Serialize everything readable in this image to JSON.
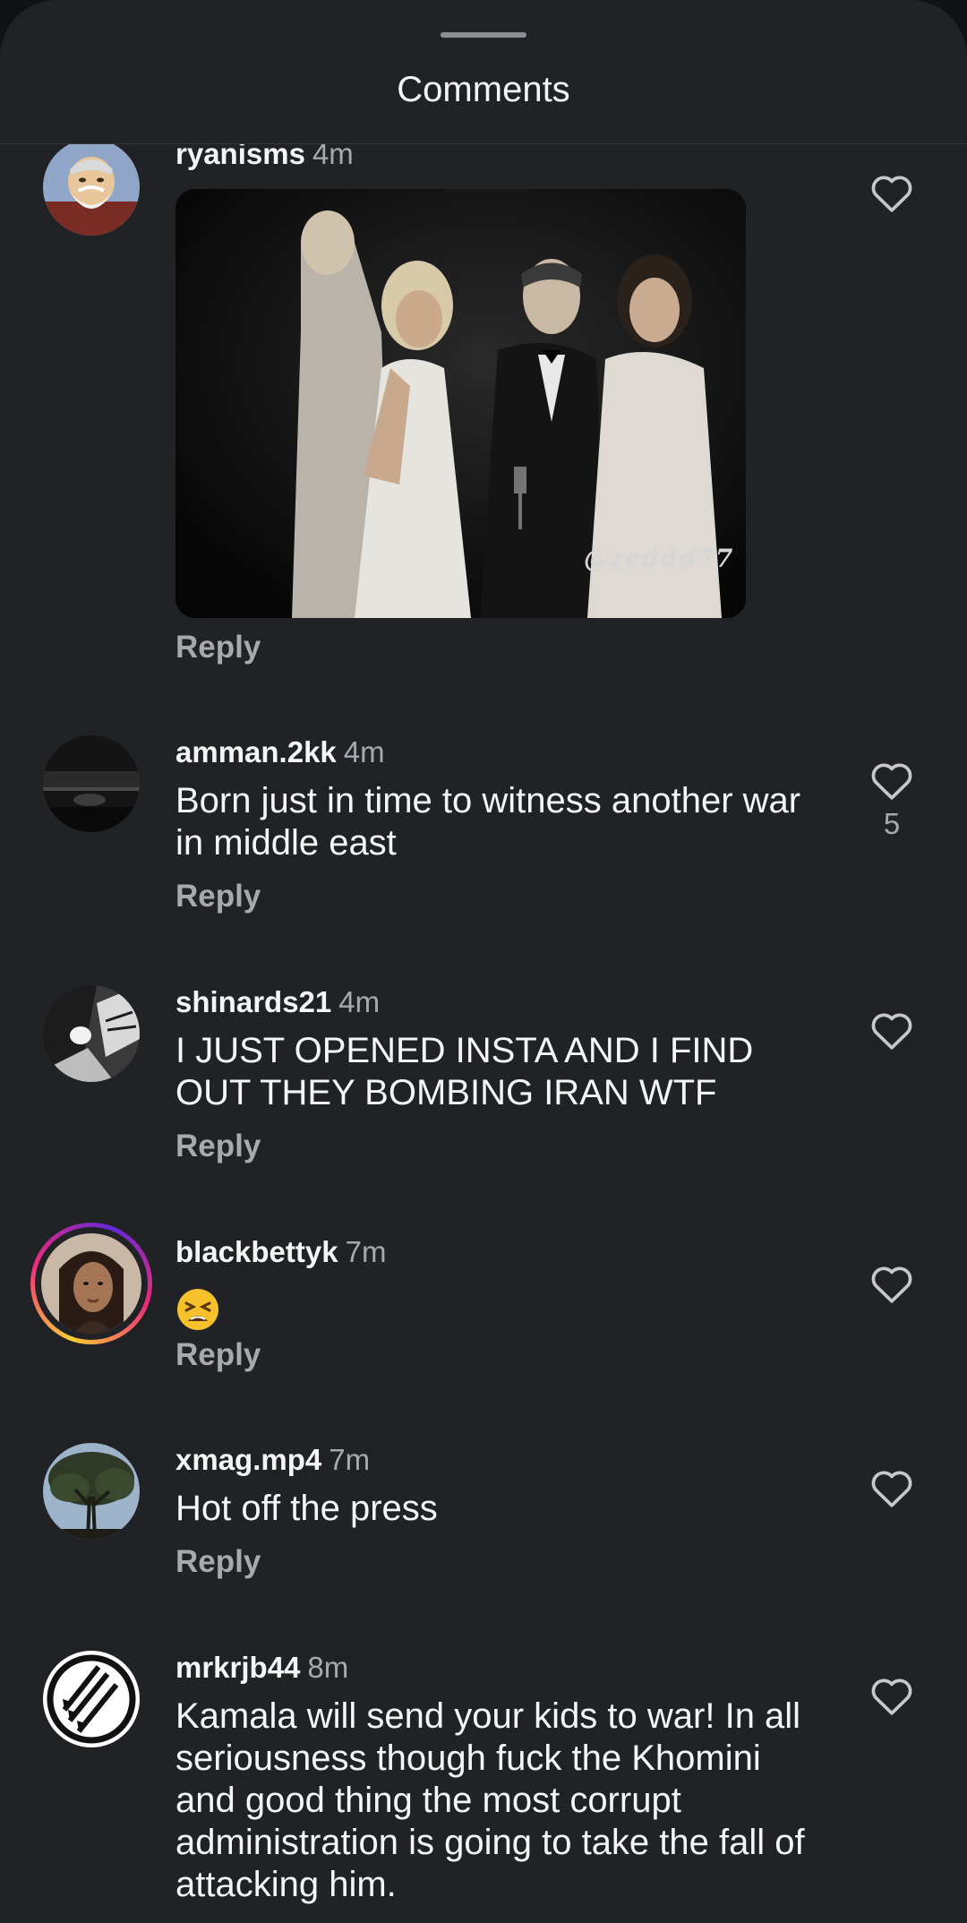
{
  "header": {
    "title": "Comments"
  },
  "comments": [
    {
      "username": "ryanisms",
      "time": "4m",
      "media_watermark": "@zeddd77",
      "reply_label": "Reply",
      "avatar_icon": "cartoon-old-man-avatar"
    },
    {
      "username": "amman.2kk",
      "time": "4m",
      "text": "Born just in time to witness another war in middle east",
      "reply_label": "Reply",
      "likes": "5",
      "avatar_icon": "dark-racing-photo-avatar"
    },
    {
      "username": "shinards21",
      "time": "4m",
      "text": "I JUST OPENED INSTA AND I FIND OUT THEY BOMBING IRAN WTF",
      "reply_label": "Reply",
      "avatar_icon": "manga-panel-avatar"
    },
    {
      "username": "blackbettyk",
      "time": "7m",
      "emoji": "😫",
      "reply_label": "Reply",
      "avatar_icon": "portrait-photo-avatar"
    },
    {
      "username": "xmag.mp4",
      "time": "7m",
      "text": "Hot off the press",
      "reply_label": "Reply",
      "avatar_icon": "tree-photo-avatar"
    },
    {
      "username": "mrkrjb44",
      "time": "8m",
      "text": "Kamala will send your kids to war! In all seriousness though fuck the Khomini and good thing the most corrupt administration is going to take the fall of attacking him.",
      "avatar_icon": "three-arrows-symbol-avatar"
    }
  ],
  "colors": {
    "sheet_background": "#212226",
    "outer_background": "#111214",
    "secondary_text": "#a8a8ad",
    "primary_text": "#f5f5f5"
  }
}
